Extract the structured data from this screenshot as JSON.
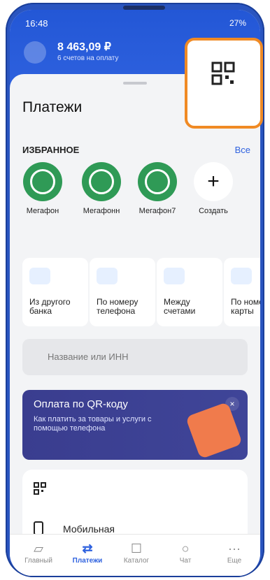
{
  "status_bar": {
    "time": "16:48",
    "right": "27%"
  },
  "header": {
    "balance": "8 463,09 ₽",
    "bills": "6 счетов на оплату"
  },
  "page": {
    "title": "Платежи"
  },
  "favorites": {
    "header": "ИЗБРАННОЕ",
    "all": "Все",
    "items": [
      {
        "label": "Мегафон"
      },
      {
        "label": "Мегафонн"
      },
      {
        "label": "Мегафон7"
      },
      {
        "label": "Создать"
      }
    ]
  },
  "quick_actions": [
    {
      "label": "Из другого банка"
    },
    {
      "label": "По номеру телефона"
    },
    {
      "label": "Между счетами"
    },
    {
      "label": "По номеру карты"
    }
  ],
  "search": {
    "placeholder": "Название или ИНН"
  },
  "qr_banner": {
    "title": "Оплата по QR-коду",
    "subtitle": "Как платить за товары и услуги с помощью телефона"
  },
  "list": {
    "items": [
      {
        "label": ""
      },
      {
        "label": "Мобильная связь"
      }
    ]
  },
  "bottom_nav": {
    "tabs": [
      {
        "label": "Главный"
      },
      {
        "label": "Платежи"
      },
      {
        "label": "Каталог"
      },
      {
        "label": "Чат"
      },
      {
        "label": "Еще"
      }
    ]
  }
}
